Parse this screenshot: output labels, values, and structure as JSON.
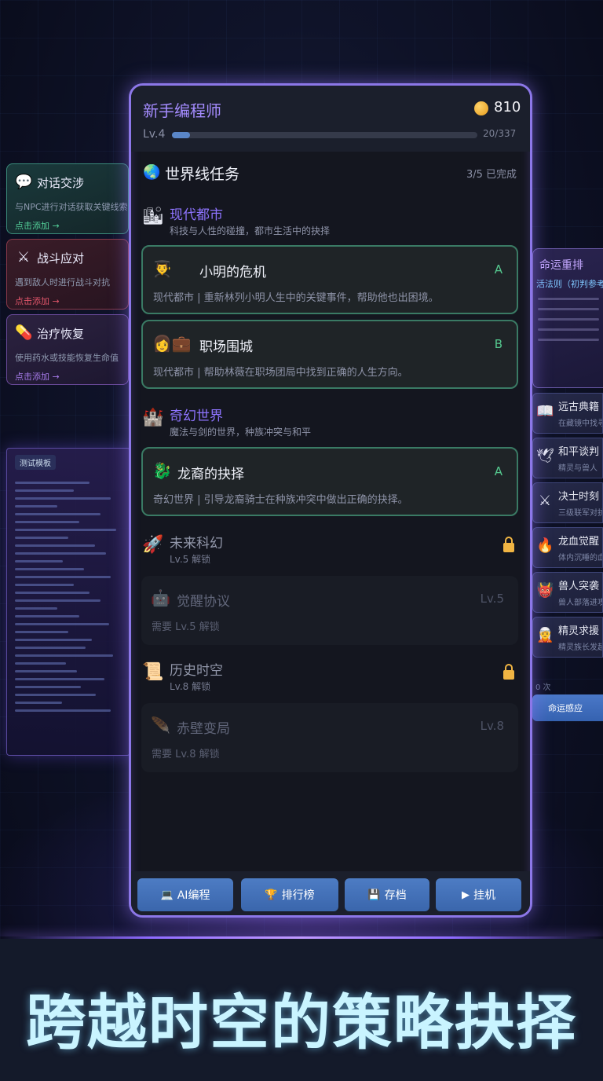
{
  "tagline": "跨越时空的策略抉择",
  "left_cards": [
    {
      "title": "对话交涉",
      "desc": "与NPC进行对话获取关键线索",
      "cta": "点击添加 →",
      "icon": "speech-bubble-icon",
      "glyph": "💬"
    },
    {
      "title": "战斗应对",
      "desc": "遇到敌人时进行战斗对抗",
      "cta": "点击添加 →",
      "icon": "crossed-swords-icon",
      "glyph": "⚔"
    },
    {
      "title": "治疗恢复",
      "desc": "使用药水或技能恢复生命值",
      "cta": "点击添加 →",
      "icon": "pill-icon",
      "glyph": "💊"
    }
  ],
  "code_panel": {
    "tab": "测试模板"
  },
  "right_top": {
    "title": "命运重排",
    "subtitle": "活法则（初判参考）"
  },
  "right_items": [
    {
      "title": "远古典籍",
      "desc": "在藏镜中找寻",
      "icon": "book-icon",
      "glyph": "📖"
    },
    {
      "title": "和平谈判",
      "desc": "精灵与兽人",
      "icon": "dove-icon",
      "glyph": "🕊"
    },
    {
      "title": "决士时刻",
      "desc": "三级联军对抗",
      "icon": "crossed-swords-icon",
      "glyph": "⚔"
    },
    {
      "title": "龙血觉醒",
      "desc": "体内沉睡的血",
      "icon": "fire-icon",
      "glyph": "🔥"
    },
    {
      "title": "兽人突袭",
      "desc": "兽人部落进攻",
      "icon": "ogre-mask-icon",
      "glyph": "👹"
    },
    {
      "title": "精灵求援",
      "desc": "精灵族长发起",
      "icon": "elf-icon",
      "glyph": "🧝"
    }
  ],
  "right_count": "0 次",
  "right_button": "命运感应",
  "header": {
    "title": "新手编程师",
    "coins": "810",
    "level": "Lv.4",
    "xp_text": "20/337",
    "xp_fraction": 0.06
  },
  "section": {
    "title": "世界线任务",
    "progress": "3/5 已完成",
    "icon": "globe-icon",
    "glyph": "🌏"
  },
  "worlds": [
    {
      "name": "现代都市",
      "desc": "科技与人性的碰撞，都市生活中的抉择",
      "icon": "city-icon",
      "glyph": "🏙",
      "locked": false
    },
    {
      "name": "奇幻世界",
      "desc": "魔法与剑的世界，种族冲突与和平",
      "icon": "castle-icon",
      "glyph": "🏰",
      "locked": false
    },
    {
      "name": "未来科幻",
      "desc": "Lv.5 解锁",
      "icon": "rocket-icon",
      "glyph": "🚀",
      "locked": true
    },
    {
      "name": "历史时空",
      "desc": "Lv.8 解锁",
      "icon": "scroll-icon",
      "glyph": "📜",
      "locked": true
    }
  ],
  "missions": [
    {
      "title": "小明的危机",
      "grade": "A",
      "desc": "现代都市 | 重新林列小明人生中的关键事件，帮助他也出困境。",
      "icons": "👨‍🎓",
      "icon": "student-icon"
    },
    {
      "title": "职场围城",
      "grade": "B",
      "desc": "现代都市 | 帮助林薇在职场团局中找到正确的人生方向。",
      "icons": "👩💼",
      "icon": "briefcase-icon"
    },
    {
      "title": "龙裔的抉择",
      "grade": "A",
      "desc": "奇幻世界 | 引导龙裔骑士在种族冲突中做出正确的抉择。",
      "icons": "🐉",
      "icon": "dragon-icon"
    },
    {
      "title": "觉醒协议",
      "grade": "Lv.5",
      "desc": "需要 Lv.5 解锁",
      "icons": "🤖",
      "icon": "robot-icon"
    },
    {
      "title": "赤壁变局",
      "grade": "Lv.8",
      "desc": "需要 Lv.8 解锁",
      "icons": "🪶",
      "icon": "feather-icon"
    }
  ],
  "dock": [
    {
      "label": "AI编程",
      "icon": "laptop-icon",
      "glyph": "💻"
    },
    {
      "label": "排行榜",
      "icon": "trophy-icon",
      "glyph": "🏆"
    },
    {
      "label": "存档",
      "icon": "floppy-disk-icon",
      "glyph": "💾"
    },
    {
      "label": "挂机",
      "icon": "play-icon",
      "glyph": "▶"
    }
  ],
  "colors": {
    "accent": "#8c77e8",
    "grade": "#55c98f",
    "coin": "#f1b543",
    "button": "#4d7cc4"
  }
}
